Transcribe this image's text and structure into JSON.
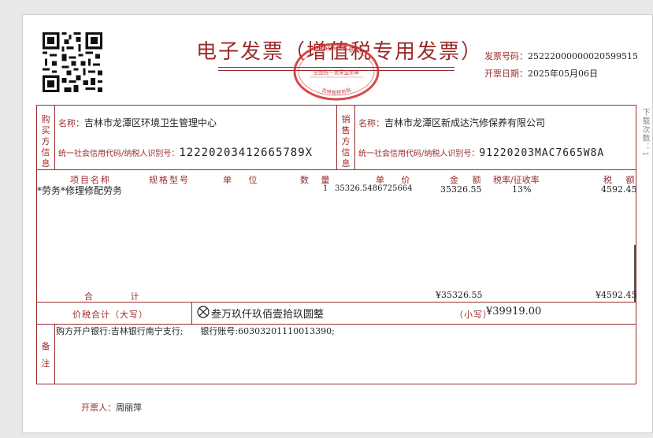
{
  "invoice": {
    "title": "电子发票（增值税专用发票）",
    "seal": {
      "top_text": "吉林省税务局",
      "center_text": "全国统一发票监制章",
      "bottom_text": "吉林省税务局"
    },
    "number_label": "发票号码：",
    "number_value": "25222000000020599515",
    "date_label": "开票日期：",
    "date_value": "2025年05月06日"
  },
  "buyer": {
    "side_label": "购买方信息",
    "name_label": "名称：",
    "name_value": "吉林市龙潭区环境卫生管理中心",
    "taxid_label": "统一社会信用代码/纳税人识别号：",
    "taxid_value": "12220203412665789X"
  },
  "seller": {
    "side_label": "销售方信息",
    "name_label": "名称：",
    "name_value": "吉林市龙潭区新成达汽修保养有限公司",
    "taxid_label": "统一社会信用代码/纳税人识别号：",
    "taxid_value": "91220203MAC7665W8A"
  },
  "items_header": {
    "name": "项目名称",
    "spec": "规格型号",
    "unit": "单 位",
    "qty": "数 量",
    "price": "单 价",
    "amount": "金 额",
    "rate": "税率/征收率",
    "tax": "税 额"
  },
  "items": [
    {
      "name": "*劳务*修理修配劳务",
      "spec": "",
      "unit": "",
      "qty": "1",
      "price": "35326.5486725664",
      "amount": "35326.55",
      "rate": "13%",
      "tax": "4592.45"
    }
  ],
  "totals": {
    "label": "合 计",
    "amount": "¥35326.55",
    "tax": "¥4592.45"
  },
  "grand_total": {
    "label": "价税合计（大写）",
    "uppercase": "叁万玖仟玖佰壹拾玖圆整",
    "lowercase_label": "（小写）",
    "lowercase_value": "¥39919.00"
  },
  "remarks": {
    "side_label": "备注",
    "text": "购方开户银行:吉林银行南宁支行;　　银行账号:60303201110013390;"
  },
  "issuer": {
    "label": "开票人：",
    "name": "周丽萍"
  },
  "side_note": "下载次数：1",
  "colors": {
    "accent": "#9b2b2b",
    "seal": "#cc2a2a"
  }
}
